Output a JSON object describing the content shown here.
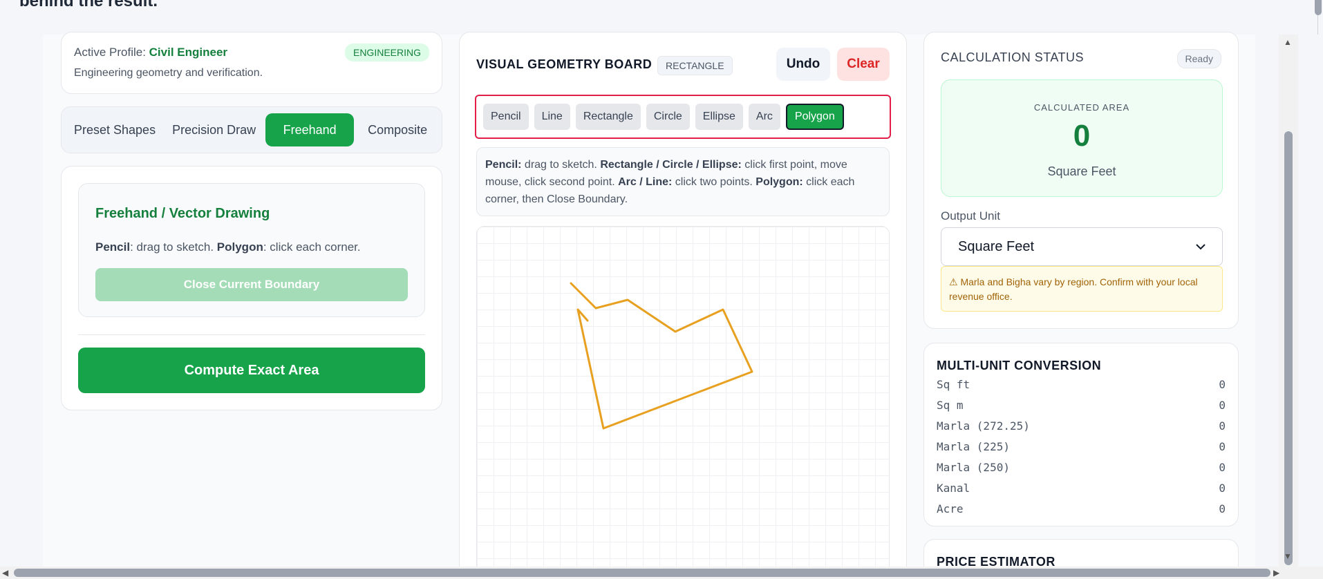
{
  "page": {
    "cut_heading": "behind the result."
  },
  "profile": {
    "active_label": "Active Profile: ",
    "name": "Civil Engineer",
    "description": "Engineering geometry and verification.",
    "badge": "ENGINEERING"
  },
  "mode_tabs": [
    "Preset Shapes",
    "Precision Draw",
    "Freehand",
    "Composite"
  ],
  "mode_active": "Freehand",
  "draw_panel": {
    "title": "Freehand / Vector Drawing",
    "desc_pencil": "Pencil",
    "desc_pencil_text": ": drag to sketch. ",
    "desc_polygon": "Polygon",
    "desc_polygon_text": ": click each corner.",
    "close_button": "Close Current Boundary",
    "compute_button": "Compute Exact Area"
  },
  "board": {
    "title": "VISUAL GEOMETRY BOARD",
    "shape_tag": "RECTANGLE",
    "undo": "Undo",
    "clear": "Clear",
    "tools": [
      "Pencil",
      "Line",
      "Rectangle",
      "Circle",
      "Ellipse",
      "Arc",
      "Polygon"
    ],
    "active_tool": "Polygon",
    "help": {
      "pencil_label": "Pencil:",
      "pencil_text": " drag to sketch.   ",
      "shapes_label": "Rectangle / Circle / Ellipse:",
      "shapes_text": " click first point, move mouse, click second point.   ",
      "arc_label": "Arc / Line:",
      "arc_text": " click two points.   ",
      "polygon_label": "Polygon:",
      "polygon_text": " click each corner, then Close Boundary."
    },
    "stroke_color": "#e8a020"
  },
  "status": {
    "title": "CALCULATION STATUS",
    "badge": "Ready",
    "area_label": "CALCULATED AREA",
    "area_value": "0",
    "area_unit": "Square Feet",
    "output_label": "Output Unit",
    "output_selected": "Square Feet",
    "warning": "⚠ Marla and Bigha vary by region. Confirm with your local revenue office."
  },
  "conversion": {
    "title": "MULTI-UNIT CONVERSION",
    "rows": [
      {
        "unit": "Sq ft",
        "value": "0"
      },
      {
        "unit": "Sq m",
        "value": "0"
      },
      {
        "unit": "Marla (272.25)",
        "value": "0"
      },
      {
        "unit": "Marla (225)",
        "value": "0"
      },
      {
        "unit": "Marla (250)",
        "value": "0"
      },
      {
        "unit": "Kanal",
        "value": "0"
      },
      {
        "unit": "Acre",
        "value": "0"
      }
    ]
  },
  "price": {
    "title": "PRICE ESTIMATOR"
  },
  "icons": {
    "select": "chevron-down-icon",
    "scroll_up": "triangle-up-icon",
    "scroll_down": "triangle-down-icon",
    "scroll_left": "triangle-left-icon",
    "scroll_right": "triangle-right-icon"
  },
  "colors": {
    "accent": "#16a34a",
    "danger": "#dc2626",
    "highlight": "#e11d48"
  }
}
